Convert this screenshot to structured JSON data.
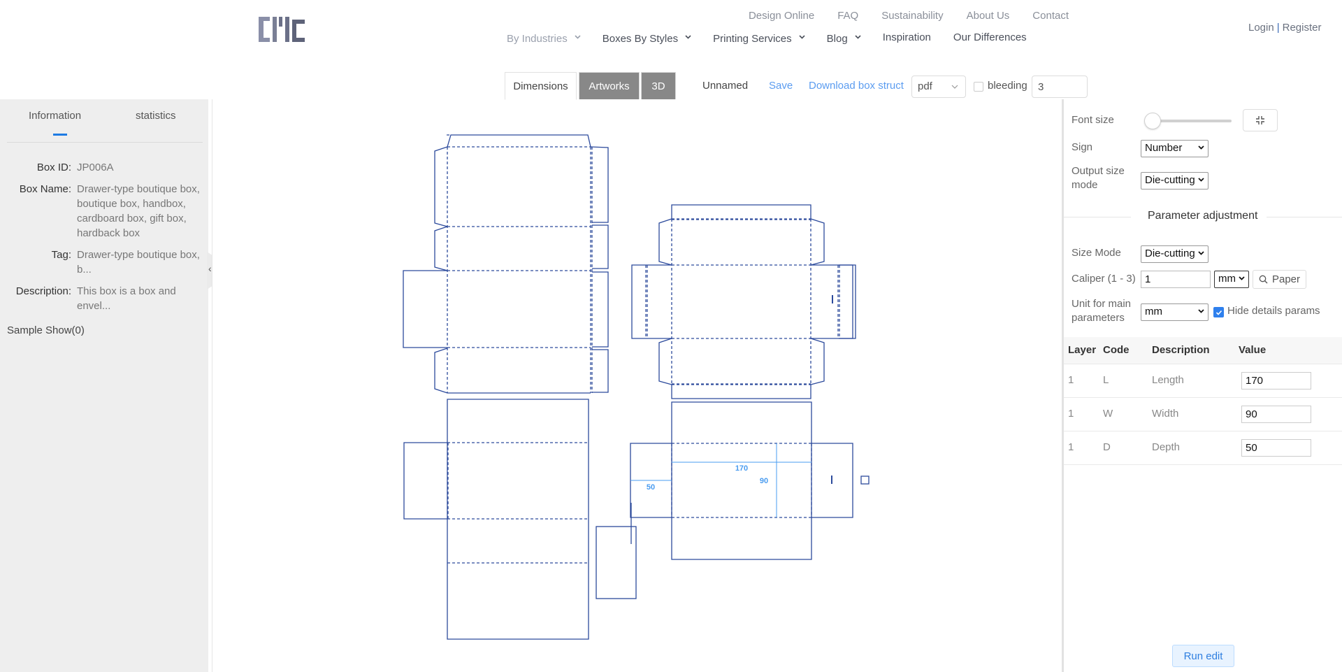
{
  "header": {
    "logo_text": "CMC",
    "top_links": [
      "Design Online",
      "FAQ",
      "Sustainability",
      "About Us",
      "Contact"
    ],
    "main_nav": [
      {
        "label": "By Industries",
        "dropdown": true,
        "muted": true
      },
      {
        "label": "Boxes By Styles",
        "dropdown": true
      },
      {
        "label": "Printing Services",
        "dropdown": true
      },
      {
        "label": "Blog",
        "dropdown": true
      },
      {
        "label": "Inspiration",
        "dropdown": false
      },
      {
        "label": "Our Differences",
        "dropdown": false
      }
    ],
    "auth": {
      "login": "Login",
      "separator": "|",
      "register": "Register"
    }
  },
  "toolbar": {
    "tabs": [
      {
        "label": "Dimensions",
        "active": true
      },
      {
        "label": "Artworks",
        "active": false
      },
      {
        "label": "3D",
        "active": false
      }
    ],
    "project_name": "Unnamed",
    "save_label": "Save",
    "download_label": "Download box struct",
    "format_select": "pdf",
    "bleeding_label": "bleeding",
    "bleeding_checked": false,
    "bleeding_value": "3"
  },
  "sidebar": {
    "tabs": [
      "Information",
      "statistics"
    ],
    "active_tab": "Information",
    "fields": [
      {
        "label": "Box ID:",
        "value": "JP006A"
      },
      {
        "label": "Box Name:",
        "value": "Drawer-type boutique box, boutique box, handbox, cardboard box, gift box, hardback box"
      },
      {
        "label": "Tag:",
        "value": "Drawer-type boutique box, b..."
      },
      {
        "label": "Description:",
        "value": "This box is a box and envel..."
      }
    ],
    "sample_show": "Sample Show(0)",
    "collapse_glyph": "‹"
  },
  "canvas": {
    "dimension_labels": {
      "length": "170",
      "width": "90",
      "depth": "50"
    },
    "line_color": "#2c4a9c",
    "dim_color": "#4a9cf0"
  },
  "right_panel": {
    "font_size_label": "Font size",
    "font_size_fraction": 0.0,
    "sign_label": "Sign",
    "sign_value": "Number",
    "output_mode_label": "Output size mode",
    "output_mode_value": "Die-cutting",
    "section_title": "Parameter adjustment",
    "size_mode_label": "Size Mode",
    "size_mode_value": "Die-cutting",
    "caliper_label": "Caliper (1 - 3)",
    "caliper_value": "1",
    "caliper_unit": "mm",
    "paper_button": "Paper",
    "unit_label": "Unit for main parameters",
    "unit_value": "mm",
    "hide_details_label": "Hide details params",
    "hide_details_checked": true,
    "table": {
      "headers": [
        "Layer",
        "Code",
        "Description",
        "Value"
      ],
      "rows": [
        {
          "layer": "1",
          "code": "L",
          "description": "Length",
          "value": "170"
        },
        {
          "layer": "1",
          "code": "W",
          "description": "Width",
          "value": "90"
        },
        {
          "layer": "1",
          "code": "D",
          "description": "Depth",
          "value": "50"
        }
      ]
    },
    "run_button": "Run edit"
  },
  "colors": {
    "accent": "#1e7be3",
    "link": "#5b9cf0",
    "tab_dark": "#888888",
    "run_bg": "#e8f3ff"
  }
}
